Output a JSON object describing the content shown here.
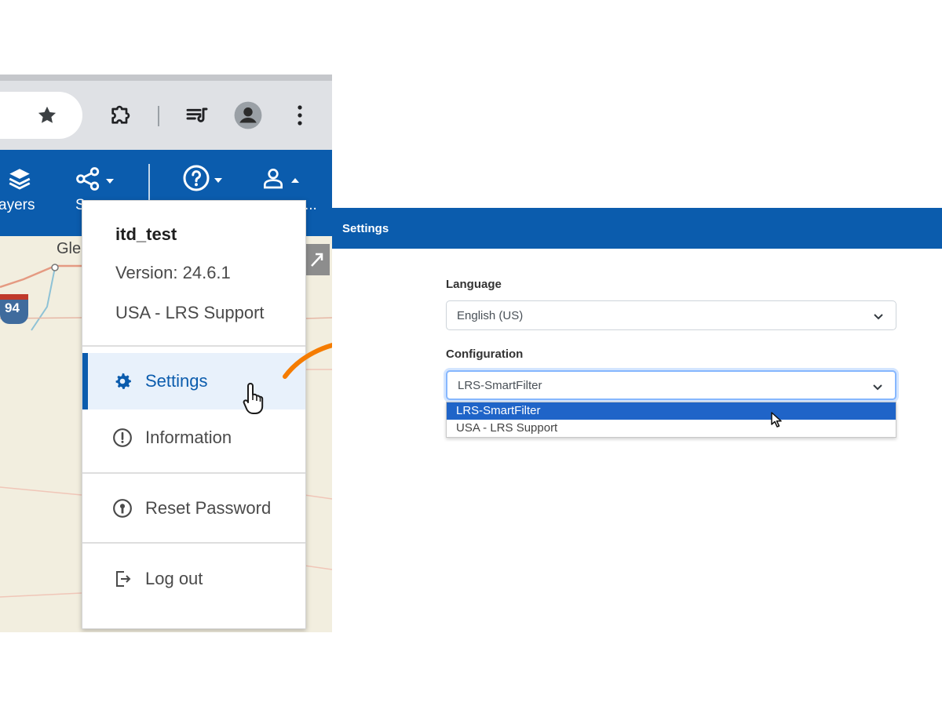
{
  "browser": {
    "icons": [
      "star-icon",
      "extension-icon",
      "playlist-icon",
      "profile-icon",
      "more-vert-icon"
    ]
  },
  "app_toolbar": {
    "layers_label": "ayers",
    "share_label": "S",
    "user_label": "...",
    "icons": [
      "layers-icon",
      "share-icon",
      "help-icon",
      "user-icon"
    ]
  },
  "map": {
    "place_label": "Gle",
    "shield_label": "94"
  },
  "user_menu": {
    "username": "itd_test",
    "version": "Version: 24.6.1",
    "configuration": "USA - LRS Support",
    "items": [
      {
        "label": "Settings",
        "icon": "gear-icon",
        "active": true
      },
      {
        "label": "Information",
        "icon": "info-icon",
        "active": false
      },
      {
        "label": "Reset Password",
        "icon": "key-icon",
        "active": false
      },
      {
        "label": "Log out",
        "icon": "logout-icon",
        "active": false
      }
    ]
  },
  "settings": {
    "title": "Settings",
    "language": {
      "label": "Language",
      "value": "English (US)"
    },
    "configuration": {
      "label": "Configuration",
      "value": "LRS-SmartFilter",
      "options": [
        "LRS-SmartFilter",
        "USA - LRS Support"
      ],
      "selected_option": "LRS-SmartFilter"
    }
  },
  "colors": {
    "brand_blue": "#0b5cad",
    "arrow_orange": "#f57c00",
    "option_highlight": "#1f64c8"
  }
}
